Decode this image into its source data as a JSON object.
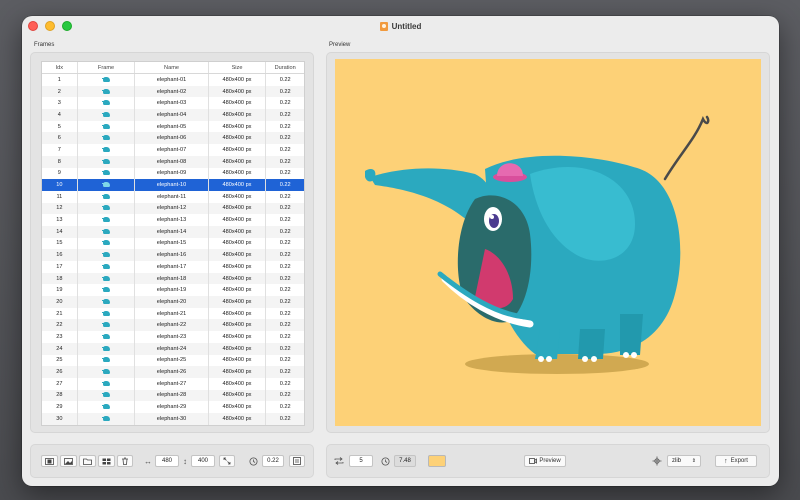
{
  "window": {
    "title": "Untitled"
  },
  "frames": {
    "section_label": "Frames",
    "columns": [
      "Idx",
      "Frame",
      "Name",
      "Size",
      "Duration"
    ],
    "selected_index": 10,
    "rows": [
      {
        "idx": "1",
        "name": "elephant-01",
        "size": "480x400 px",
        "duration": "0.22"
      },
      {
        "idx": "2",
        "name": "elephant-02",
        "size": "480x400 px",
        "duration": "0.22"
      },
      {
        "idx": "3",
        "name": "elephant-03",
        "size": "480x400 px",
        "duration": "0.22"
      },
      {
        "idx": "4",
        "name": "elephant-04",
        "size": "480x400 px",
        "duration": "0.22"
      },
      {
        "idx": "5",
        "name": "elephant-05",
        "size": "480x400 px",
        "duration": "0.22"
      },
      {
        "idx": "6",
        "name": "elephant-06",
        "size": "480x400 px",
        "duration": "0.22"
      },
      {
        "idx": "7",
        "name": "elephant-07",
        "size": "480x400 px",
        "duration": "0.22"
      },
      {
        "idx": "8",
        "name": "elephant-08",
        "size": "480x400 px",
        "duration": "0.22"
      },
      {
        "idx": "9",
        "name": "elephant-09",
        "size": "480x400 px",
        "duration": "0.22"
      },
      {
        "idx": "10",
        "name": "elephant-10",
        "size": "480x400 px",
        "duration": "0.22"
      },
      {
        "idx": "11",
        "name": "elephant-11",
        "size": "480x400 px",
        "duration": "0.22"
      },
      {
        "idx": "12",
        "name": "elephant-12",
        "size": "480x400 px",
        "duration": "0.22"
      },
      {
        "idx": "13",
        "name": "elephant-13",
        "size": "480x400 px",
        "duration": "0.22"
      },
      {
        "idx": "14",
        "name": "elephant-14",
        "size": "480x400 px",
        "duration": "0.22"
      },
      {
        "idx": "15",
        "name": "elephant-15",
        "size": "480x400 px",
        "duration": "0.22"
      },
      {
        "idx": "16",
        "name": "elephant-16",
        "size": "480x400 px",
        "duration": "0.22"
      },
      {
        "idx": "17",
        "name": "elephant-17",
        "size": "480x400 px",
        "duration": "0.22"
      },
      {
        "idx": "18",
        "name": "elephant-18",
        "size": "480x400 px",
        "duration": "0.22"
      },
      {
        "idx": "19",
        "name": "elephant-19",
        "size": "480x400 px",
        "duration": "0.22"
      },
      {
        "idx": "20",
        "name": "elephant-20",
        "size": "480x400 px",
        "duration": "0.22"
      },
      {
        "idx": "21",
        "name": "elephant-21",
        "size": "480x400 px",
        "duration": "0.22"
      },
      {
        "idx": "22",
        "name": "elephant-22",
        "size": "480x400 px",
        "duration": "0.22"
      },
      {
        "idx": "23",
        "name": "elephant-23",
        "size": "480x400 px",
        "duration": "0.22"
      },
      {
        "idx": "24",
        "name": "elephant-24",
        "size": "480x400 px",
        "duration": "0.22"
      },
      {
        "idx": "25",
        "name": "elephant-25",
        "size": "480x400 px",
        "duration": "0.22"
      },
      {
        "idx": "26",
        "name": "elephant-26",
        "size": "480x400 px",
        "duration": "0.22"
      },
      {
        "idx": "27",
        "name": "elephant-27",
        "size": "480x400 px",
        "duration": "0.22"
      },
      {
        "idx": "28",
        "name": "elephant-28",
        "size": "480x400 px",
        "duration": "0.22"
      },
      {
        "idx": "29",
        "name": "elephant-29",
        "size": "480x400 px",
        "duration": "0.22"
      },
      {
        "idx": "30",
        "name": "elephant-30",
        "size": "480x400 px",
        "duration": "0.22"
      }
    ]
  },
  "preview": {
    "section_label": "Preview",
    "background_color": "#fdd177",
    "subject_icon": "elephant-illustration"
  },
  "left_toolbar": {
    "width_value": "480",
    "height_value": "400",
    "duration_value": "0.22"
  },
  "right_toolbar": {
    "loop_count": "5",
    "total_time": "7.48",
    "bg_swatch_color": "#fdd177",
    "preview_label": "Preview",
    "compression_value": "zlib",
    "export_label": "Export"
  },
  "colors": {
    "selection": "#1f63d6",
    "elephant_body": "#2ba9bf",
    "hat": "#e66ab0"
  }
}
